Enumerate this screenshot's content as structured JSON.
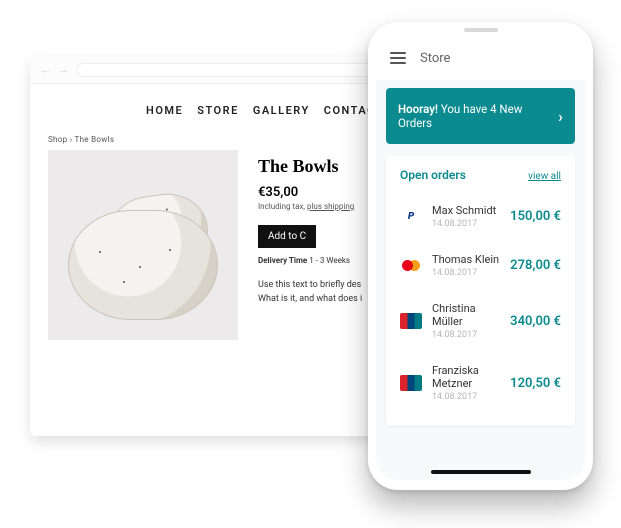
{
  "browser": {
    "nav": {
      "back": "←",
      "forward": "→"
    },
    "site_nav": [
      "HOME",
      "STORE",
      "GALLERY",
      "CONTACT"
    ],
    "breadcrumb": "Shop  ›  The Bowls",
    "product": {
      "title": "The Bowls",
      "price": "€35,00",
      "tax_note_prefix": "Including tax, ",
      "tax_note_link": "plus shipping",
      "add_label": "Add to C",
      "delivery_label": "Delivery Time",
      "delivery_value": "1 - 3 Weeks",
      "desc_line1": "Use this text to briefly des",
      "desc_line2": "What is it, and what does i"
    }
  },
  "phone": {
    "header_title": "Store",
    "banner_bold": "Hooray!",
    "banner_rest": " You have 4 New Orders",
    "card_title": "Open orders",
    "view_all": "view all",
    "orders": [
      {
        "name": "Max Schmidt",
        "date": "14.08.2017",
        "amount": "150,00 €",
        "method": "pp"
      },
      {
        "name": "Thomas Klein",
        "date": "14.08.2017",
        "amount": "278,00 €",
        "method": "mc"
      },
      {
        "name": "Christina Müller",
        "date": "14.08.2017",
        "amount": "340,00 €",
        "method": "up"
      },
      {
        "name": "Franziska Metzner",
        "date": "14.08.2017",
        "amount": "120,50 €",
        "method": "up"
      }
    ]
  }
}
